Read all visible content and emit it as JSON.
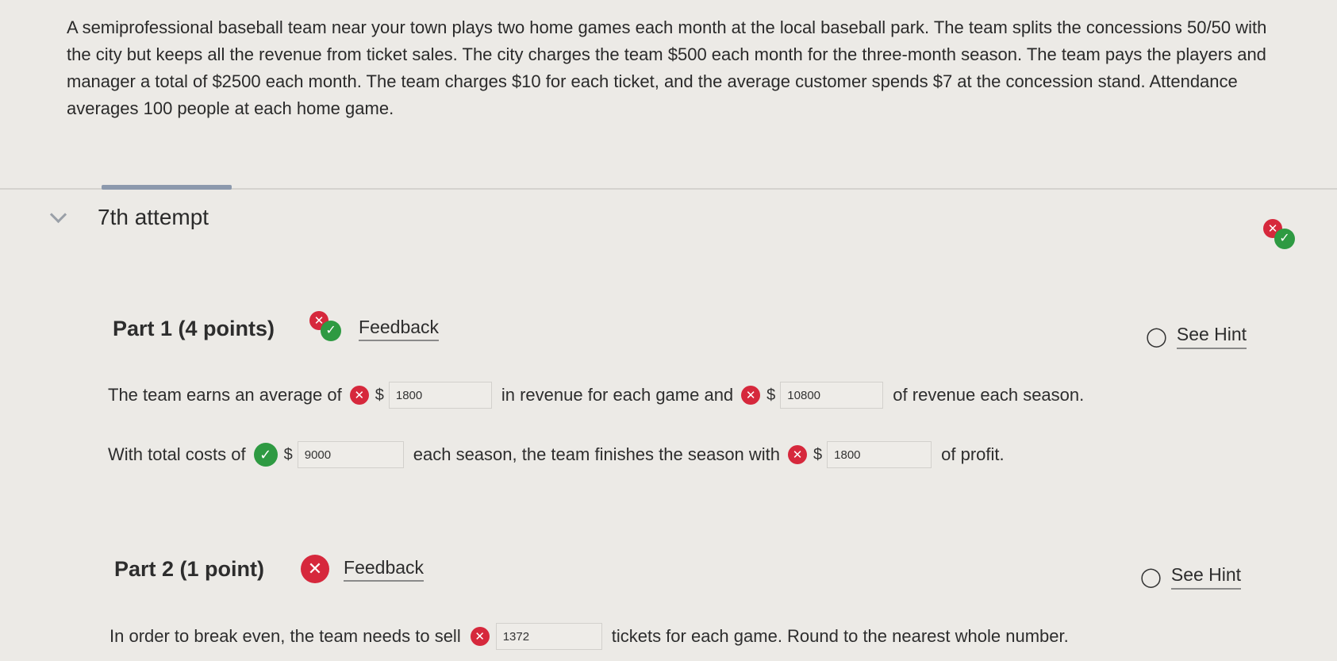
{
  "problem_text": "A semiprofessional baseball team near your town plays two home games each month at the local baseball park. The team splits the concessions 50/50 with the city but keeps all the revenue from ticket sales. The city charges the team $500 each month for the three-month season. The team pays the players and manager a total of $2500 each month. The team charges $10 for each ticket, and the average customer spends $7 at the concession stand. Attendance averages 100 people at each home game.",
  "attempt_title": "7th attempt",
  "part1": {
    "title": "Part 1  (4 points)",
    "feedback_label": "Feedback",
    "hint_label": "See Hint",
    "q1_pre": "The team earns an average of",
    "currency": "$",
    "q1_value1": "1800",
    "q1_mid": "in revenue for each game and",
    "q1_value2": "10800",
    "q1_post": "of revenue each season.",
    "q2_pre": "With total costs of",
    "q2_value1": "9000",
    "q2_mid": "each season, the team finishes the season with",
    "q2_value2": "1800",
    "q2_post": "of profit."
  },
  "part2": {
    "title": "Part 2  (1 point)",
    "feedback_label": "Feedback",
    "hint_label": "See Hint",
    "q_pre": "In order to break even, the team needs to sell",
    "q_value": "1372",
    "q_post": "tickets for each game. Round to the nearest whole number."
  },
  "icons": {
    "incorrect": "x-circle-icon",
    "correct": "check-circle-icon",
    "hint": "lightbulb-icon",
    "chevron": "chevron-down-icon"
  },
  "colors": {
    "incorrect": "#d6283c",
    "correct": "#2e9a42",
    "background": "#eceae6"
  }
}
